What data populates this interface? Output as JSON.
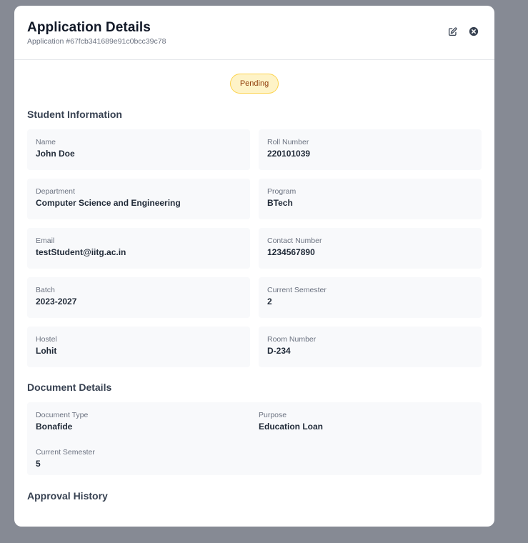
{
  "header": {
    "title": "Application Details",
    "subtitle": "Application #67fcb341689e91c0bcc39c78"
  },
  "status": "Pending",
  "student_info": {
    "title": "Student Information",
    "fields": [
      {
        "label": "Name",
        "value": "John Doe"
      },
      {
        "label": "Roll Number",
        "value": "220101039"
      },
      {
        "label": "Department",
        "value": "Computer Science and Engineering"
      },
      {
        "label": "Program",
        "value": "BTech"
      },
      {
        "label": "Email",
        "value": "testStudent@iitg.ac.in"
      },
      {
        "label": "Contact Number",
        "value": "1234567890"
      },
      {
        "label": "Batch",
        "value": "2023-2027"
      },
      {
        "label": "Current Semester",
        "value": "2"
      },
      {
        "label": "Hostel",
        "value": "Lohit"
      },
      {
        "label": "Room Number",
        "value": "D-234"
      }
    ]
  },
  "document_details": {
    "title": "Document Details",
    "fields": [
      {
        "label": "Document Type",
        "value": "Bonafide"
      },
      {
        "label": "Purpose",
        "value": "Education Loan"
      },
      {
        "label": "Current Semester",
        "value": "5"
      }
    ]
  },
  "approval_history": {
    "title": "Approval History"
  },
  "icons": {
    "edit": "edit-icon",
    "close": "close-circle-icon"
  }
}
